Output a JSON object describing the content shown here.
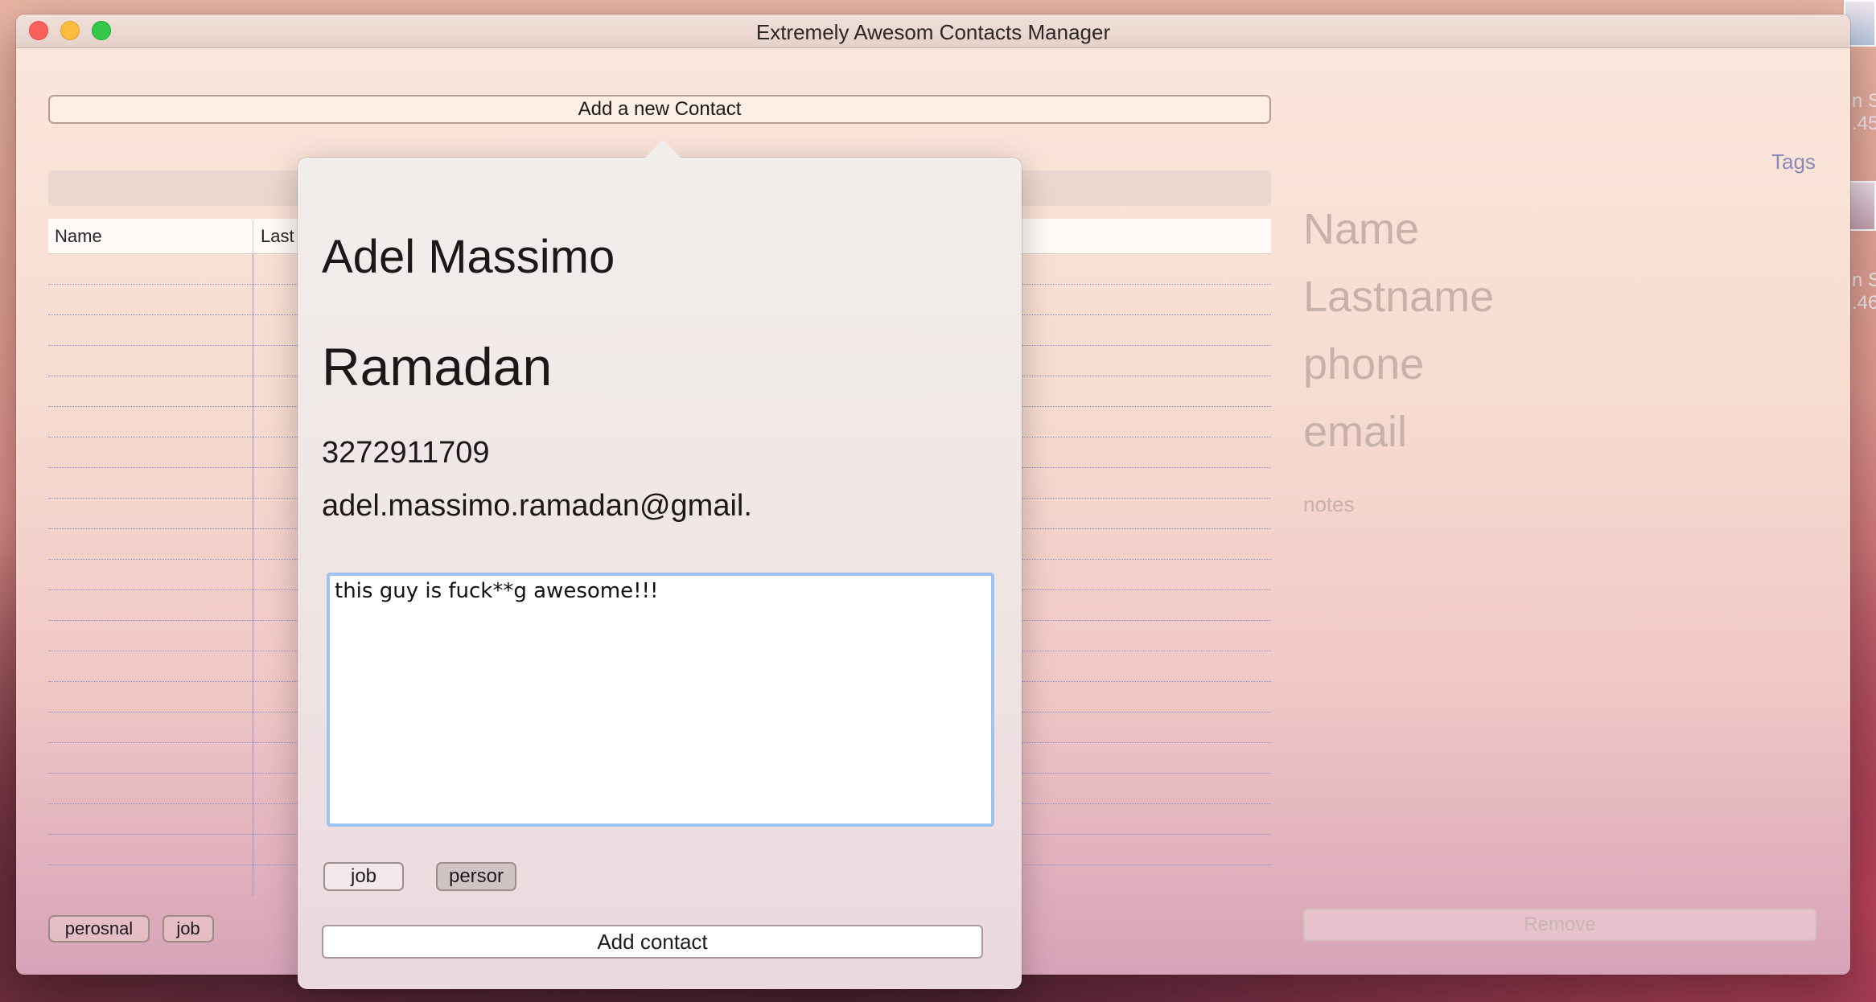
{
  "window": {
    "title": "Extremely Awesom Contacts Manager"
  },
  "toolbar": {
    "add_new_label": "Add a new Contact"
  },
  "table": {
    "columns": [
      "Name",
      "Last"
    ],
    "row_count": 20
  },
  "filter_tags": [
    "perosnal",
    "job"
  ],
  "detail": {
    "tags_link": "Tags",
    "name_placeholder": "Name",
    "lastname_placeholder": "Lastname",
    "phone_placeholder": "phone",
    "email_placeholder": "email",
    "notes_placeholder": "notes",
    "remove_label": "Remove"
  },
  "popover": {
    "name": "Adel Massimo",
    "lastname": "Ramadan",
    "phone": "3272911709",
    "email": "adel.massimo.ramadan@gmail.",
    "notes": "this guy is fuck**g awesome!!!",
    "tags": [
      "job",
      "persor"
    ],
    "submit_label": "Add contact"
  },
  "desktop": {
    "label_fragment_1": "n S",
    "label_fragment_2": ".45",
    "label_fragment_3": "n S",
    "label_fragment_4": ".46"
  }
}
